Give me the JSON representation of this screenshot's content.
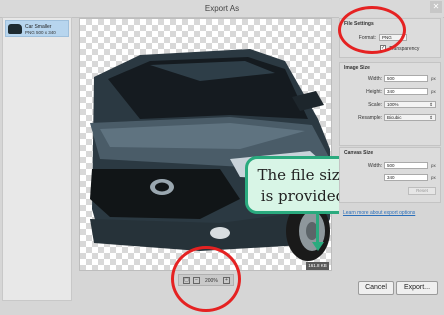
{
  "window": {
    "title": "Export As"
  },
  "asset": {
    "name": "Car Smaller",
    "meta": "PNG   500 x 340"
  },
  "preview": {
    "file_size": "161.8 KB",
    "zoom": "200%"
  },
  "file_settings": {
    "title": "File Settings",
    "format_label": "Format:",
    "format_value": "PNG",
    "transparency_label": "Transparency",
    "transparency_checked": true
  },
  "image_size": {
    "title": "Image Size",
    "width_label": "Width:",
    "width_value": "500",
    "height_label": "Height:",
    "height_value": "340",
    "scale_label": "Scale:",
    "scale_value": "100%",
    "resample_label": "Resample:",
    "resample_value": "Bicubic",
    "unit": "px"
  },
  "canvas_size": {
    "title": "Canvas Size",
    "width_label": "Width:",
    "width_value": "500",
    "height_value": "340",
    "unit": "px",
    "reset_label": "Reset"
  },
  "links": {
    "learn_more": "Learn more about export options"
  },
  "buttons": {
    "cancel": "Cancel",
    "export": "Export..."
  },
  "callout": {
    "line1": "The file size",
    "line2": "is provided"
  },
  "colors": {
    "annotation_red": "#e52222",
    "callout_green": "#2aaa7e",
    "callout_fill": "#d8f5e6",
    "selection_blue": "#b7d5ee"
  },
  "icons": [
    "close-icon",
    "fit-screen-icon",
    "zoom-out-icon",
    "zoom-in-icon",
    "checkmark-icon",
    "chevron-down-icon",
    "arrow-down-icon"
  ]
}
